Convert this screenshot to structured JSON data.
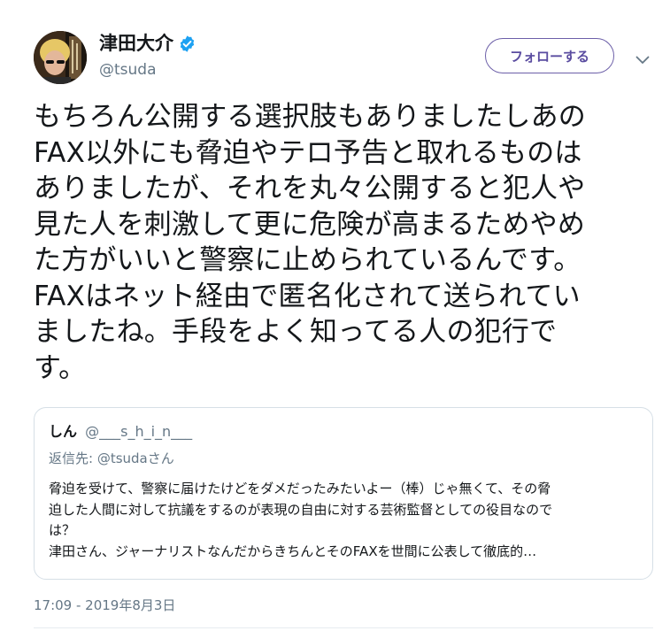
{
  "author": {
    "display_name": "津田大介",
    "handle": "@tsuda",
    "verified": true
  },
  "actions": {
    "follow_label": "フォローする",
    "more_icon": "chevron-down-icon"
  },
  "tweet": {
    "lines": [
      "もちろん公開する選択肢もありましたしあの",
      "FAX以外にも脅迫やテロ予告と取れるものは",
      "ありましたが、それを丸々公開すると犯人や",
      "見た人を刺激して更に危険が高まるためやめ",
      "た方がいいと警察に止められているんです。",
      "FAXはネット経由で匿名化されて送られてい",
      "ましたね。手段をよく知ってる人の犯行で",
      "す。"
    ],
    "timestamp": "17:09 - 2019年8月3日"
  },
  "quoted_tweet": {
    "display_name": "しん",
    "handle": "@___s_h_i_n___",
    "reply_prefix": "返信先: ",
    "reply_handle": "@tsuda",
    "reply_suffix": "さん",
    "lines": [
      "脅迫を受けて、警察に届けたけどをダメだったみたいよー（棒）じゃ無くて、その脅",
      "迫した人間に対して抗議をするのが表現の自由に対する芸術監督としての役目なので",
      "は？",
      "津田さん、ジャーナリストなんだからきちんとそのFAXを世間に公表して徹底的…"
    ]
  },
  "colors": {
    "text": "#14171a",
    "secondary": "#657786",
    "verified": "#1da1f2",
    "follow_border": "#6c5fa8",
    "follow_text": "#5a4ca0",
    "card_border": "#d6dfe6"
  }
}
